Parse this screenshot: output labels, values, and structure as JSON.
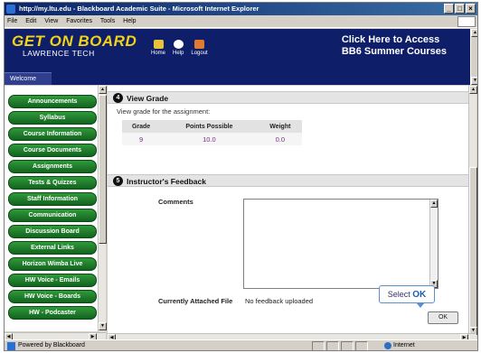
{
  "window": {
    "title": "http://my.ltu.edu - Blackboard Academic Suite - Microsoft Internet Explorer",
    "buttons": [
      "_",
      "□",
      "×"
    ]
  },
  "menubar": [
    "File",
    "Edit",
    "View",
    "Favorites",
    "Tools",
    "Help"
  ],
  "header": {
    "logo_line1": "GET ON BOARD",
    "logo_line2": "LAWRENCE TECH",
    "nav": [
      {
        "label": "Home",
        "icon": "home-icon",
        "color": "#e8c23a"
      },
      {
        "label": "Help",
        "icon": "help-icon",
        "color": "#ffffff"
      },
      {
        "label": "Logout",
        "icon": "logout-icon",
        "color": "#e07a30"
      }
    ],
    "promo_line1": "Click Here to Access",
    "promo_line2": "BB6 Summer Courses",
    "welcome_tab": "Welcome"
  },
  "sidebar": {
    "items": [
      "Announcements",
      "Syllabus",
      "Course Information",
      "Course Documents",
      "Assignments",
      "Tests & Quizzes",
      "Staff Information",
      "Communication",
      "Discussion Board",
      "External Links",
      "Horizon Wimba Live",
      "HW Voice - Emails",
      "HW Voice - Boards",
      "HW - Podcaster"
    ]
  },
  "main": {
    "section4": {
      "number": "4",
      "title": "View Grade",
      "description": "View grade for the assignment:",
      "table": {
        "headers": [
          "Grade",
          "Points Possible",
          "Weight"
        ],
        "row": [
          "9",
          "10.0",
          "0.0"
        ]
      }
    },
    "section5": {
      "number": "5",
      "title": "Instructor's Feedback",
      "comments_label": "Comments",
      "attached_label": "Currently Attached File",
      "attached_value": "No feedback uploaded"
    },
    "callout_prefix": "Select ",
    "callout_bold": "OK",
    "ok_button": "OK"
  },
  "statusbar": {
    "text": "Powered by Blackboard",
    "zone": "Internet"
  },
  "colors": {
    "header_bg": "#0f1e68",
    "logo_yellow": "#f2d21a",
    "nav_button_green": "#1f7a2a",
    "grade_value": "#7a2a8a"
  }
}
